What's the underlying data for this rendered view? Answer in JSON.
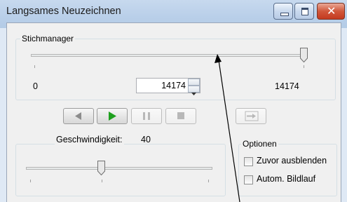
{
  "window": {
    "title": "Langsames Neuzeichnen",
    "minimize_icon": "minimize-icon",
    "maximize_icon": "maximize-icon",
    "close_icon": "close-icon",
    "close_glyph": "✕"
  },
  "stitch_manager": {
    "label": "Stichmanager",
    "min_label": "0",
    "max_label": "14174",
    "value": "14174",
    "slider_fraction": 1.0
  },
  "playback": {
    "buttons": [
      {
        "name": "step-back-button",
        "icon": "step-back-icon",
        "enabled": true
      },
      {
        "name": "play-button",
        "icon": "play-icon",
        "enabled": true
      },
      {
        "name": "pause-button",
        "icon": "pause-icon",
        "enabled": false
      },
      {
        "name": "stop-button",
        "icon": "stop-icon",
        "enabled": false
      },
      {
        "name": "jump-to-end-button",
        "icon": "jump-to-end-icon",
        "enabled": false
      }
    ]
  },
  "speed": {
    "label": "Geschwindigkeit:",
    "value": "40",
    "slider_fraction": 0.4
  },
  "options": {
    "label": "Optionen",
    "items": [
      {
        "label": "Zuvor ausblenden",
        "checked": false
      },
      {
        "label": "Autom. Bildlauf",
        "checked": false
      }
    ]
  },
  "colors": {
    "play_green": "#1ea01e",
    "disabled_gray": "#b8b8b8",
    "title_bar": "#b9cfe9",
    "close_red": "#c43a1f"
  }
}
